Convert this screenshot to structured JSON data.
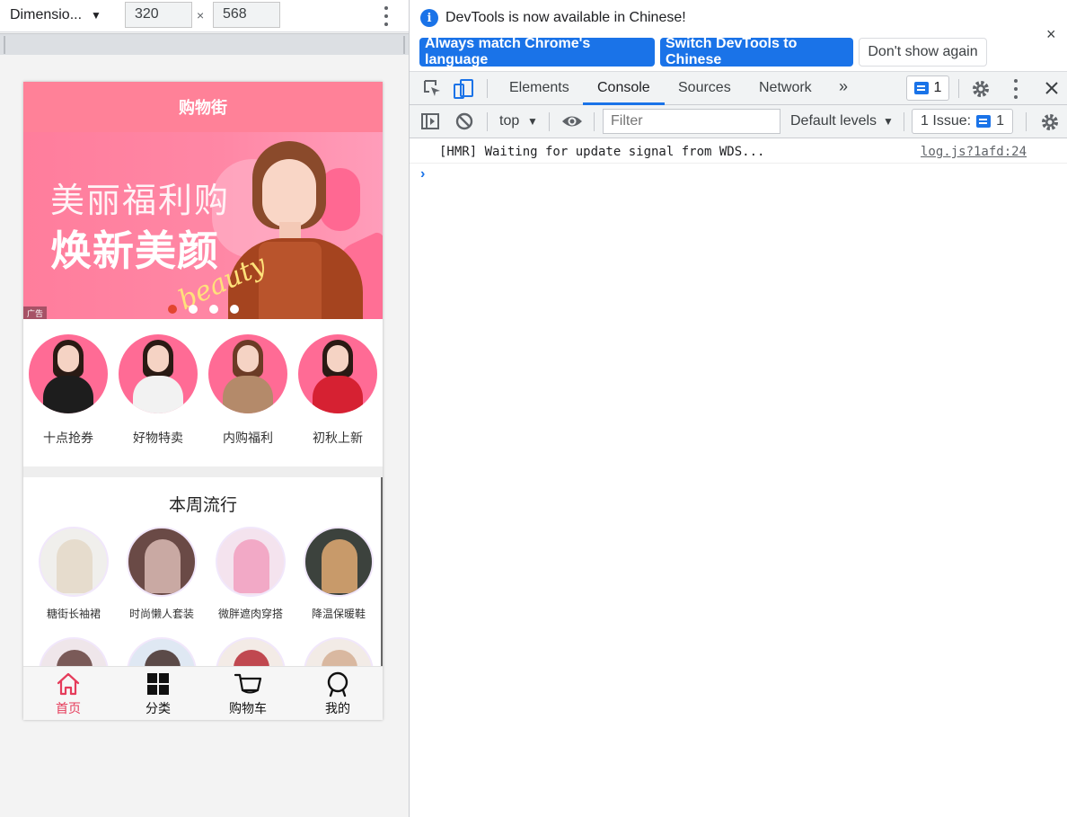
{
  "device_toolbar": {
    "dimension_label": "Dimensio...",
    "dropdown_arrow": "▼",
    "width": "320",
    "times": "×",
    "height": "568"
  },
  "app": {
    "title": "购物街",
    "banner": {
      "line1": "美丽福利购",
      "line2": "焕新美颜",
      "script": "beauty",
      "ad_tag": "广告",
      "active_dot": 1,
      "dot_count": 4
    },
    "categories": [
      {
        "label": "十点抢券"
      },
      {
        "label": "好物特卖"
      },
      {
        "label": "内购福利"
      },
      {
        "label": "初秋上新"
      }
    ],
    "weekly": {
      "title": "本周流行",
      "items": [
        {
          "label": "糖街长袖裙"
        },
        {
          "label": "时尚懒人套装"
        },
        {
          "label": "微胖遮肉穿搭"
        },
        {
          "label": "降温保暖鞋"
        },
        {
          "label": ""
        },
        {
          "label": ""
        },
        {
          "label": ""
        },
        {
          "label": ""
        }
      ]
    },
    "tabbar": [
      {
        "label": "首页",
        "icon": "home-icon",
        "active": true
      },
      {
        "label": "分类",
        "icon": "grid-icon",
        "active": false
      },
      {
        "label": "购物车",
        "icon": "cart-icon",
        "active": false
      },
      {
        "label": "我的",
        "icon": "user-icon",
        "active": false
      }
    ],
    "accent_color": "#ff8198",
    "active_tab_color": "#e53c5b"
  },
  "devtools": {
    "infobar": {
      "message": "DevTools is now available in Chinese!",
      "info_glyph": "i",
      "close_glyph": "×",
      "btn_match": "Always match Chrome's language",
      "btn_switch": "Switch DevTools to Chinese",
      "btn_dontshow": "Don't show again"
    },
    "tabs": [
      "Elements",
      "Console",
      "Sources",
      "Network"
    ],
    "active_tab": "Console",
    "more_tabs": "»",
    "messages_count": "1",
    "console_toolbar": {
      "context": "top",
      "filter_placeholder": "Filter",
      "levels": "Default levels",
      "issues_label": "1 Issue:",
      "issues_count": "1"
    },
    "log": {
      "message": "[HMR] Waiting for update signal from WDS...",
      "source": "log.js?1afd:24"
    },
    "prompt": "›",
    "accent_color": "#1a73e8"
  }
}
